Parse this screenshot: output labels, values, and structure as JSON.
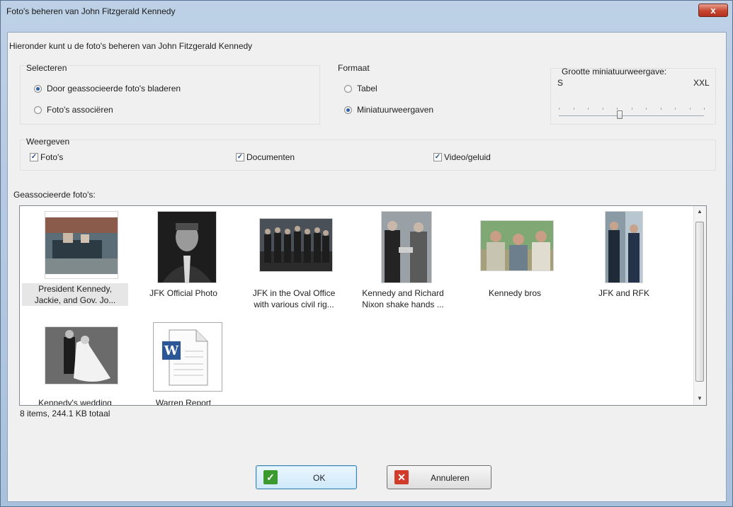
{
  "window": {
    "title": "Foto's beheren van John Fitzgerald Kennedy",
    "close_glyph": "x"
  },
  "intro": "Hieronder kunt u de foto's beheren van John Fitzgerald Kennedy",
  "select": {
    "label": "Selecteren",
    "options": [
      {
        "label": "Door geassocieerde foto's bladeren",
        "selected": true
      },
      {
        "label": "Foto's associëren",
        "selected": false
      }
    ]
  },
  "format": {
    "label": "Formaat",
    "options": [
      {
        "label": "Tabel",
        "selected": false
      },
      {
        "label": "Miniatuurweergaven",
        "selected": true
      }
    ]
  },
  "thumb_size": {
    "label": "Grootte miniatuurweergave:",
    "min_label": "S",
    "max_label": "XXL",
    "value_fraction": 0.42
  },
  "display": {
    "label": "Weergeven",
    "options": [
      {
        "label": "Foto's",
        "checked": true
      },
      {
        "label": "Documenten",
        "checked": true
      },
      {
        "label": "Video/geluid",
        "checked": true
      }
    ]
  },
  "list_label": "Geassocieerde foto's:",
  "items": [
    {
      "line1": "President Kennedy,",
      "line2": "Jackie, and Gov. Jo...",
      "icon": "photo-motorcade-icon",
      "selected": true
    },
    {
      "line1": "JFK Official Photo",
      "line2": "",
      "icon": "photo-portrait-icon",
      "selected": false
    },
    {
      "line1": "JFK in the Oval Office",
      "line2": "with various civil rig...",
      "icon": "photo-group-icon",
      "selected": false
    },
    {
      "line1": "Kennedy and Richard",
      "line2": "Nixon shake hands ...",
      "icon": "photo-handshake-icon",
      "selected": false
    },
    {
      "line1": "Kennedy bros",
      "line2": "",
      "icon": "photo-brothers-icon",
      "selected": false
    },
    {
      "line1": "JFK and RFK",
      "line2": "",
      "icon": "photo-jfk-rfk-icon",
      "selected": false
    },
    {
      "line1": "Kennedy's wedding",
      "line2": "",
      "icon": "photo-wedding-icon",
      "selected": false
    },
    {
      "line1": "Warren Report",
      "line2": "",
      "icon": "word-document-icon",
      "selected": false
    }
  ],
  "status": "8 items, 244.1 KB totaal",
  "buttons": {
    "ok": {
      "label": "OK",
      "icon": "check-icon",
      "color": "#3a9a2e"
    },
    "cancel": {
      "label": "Annuleren",
      "icon": "x-icon",
      "color": "#d23a2a"
    }
  }
}
